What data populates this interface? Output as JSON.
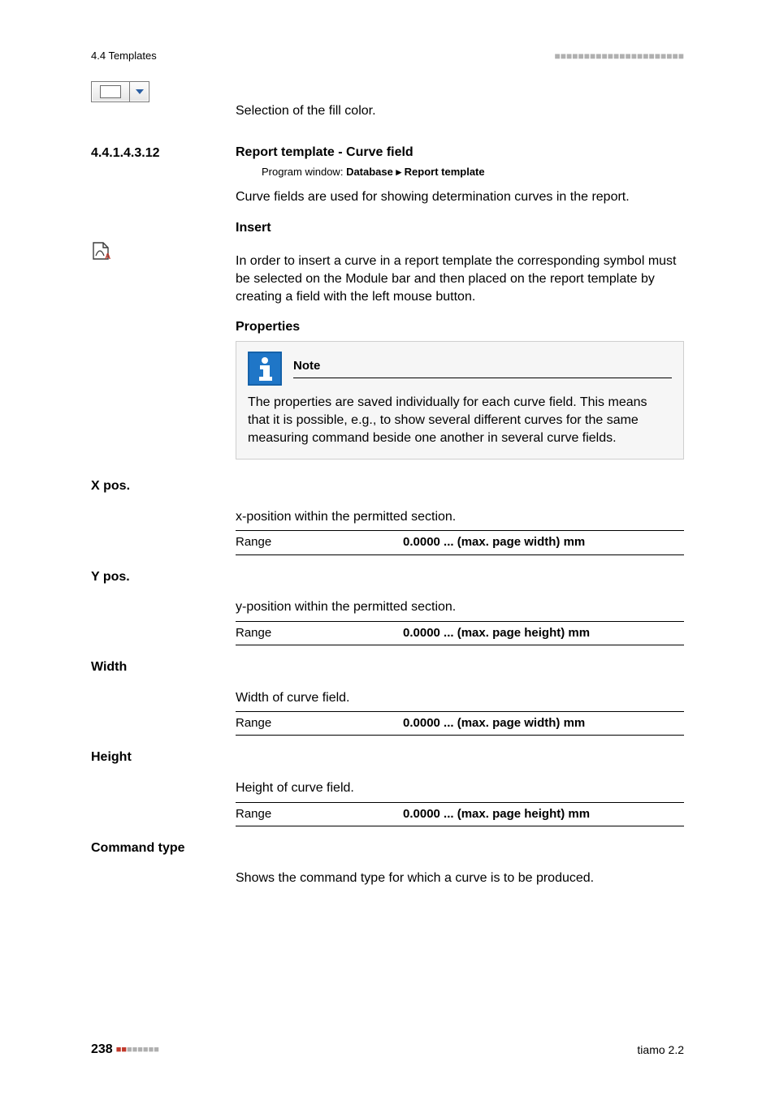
{
  "header": {
    "section": "4.4 Templates"
  },
  "fillcolor": {
    "caption": "Selection of the fill color."
  },
  "section": {
    "number": "4.4.1.4.3.12",
    "title": "Report template - Curve field",
    "program_window_label": "Program window:",
    "program_window_value_1": "Database",
    "program_window_sep": "▸",
    "program_window_value_2": "Report template",
    "intro": "Curve fields are used for showing determination curves in the report."
  },
  "insert": {
    "heading": "Insert",
    "text": "In order to insert a curve in a report template the corresponding symbol must be selected on the Module bar and then placed on the report template by creating a field with the left mouse button."
  },
  "properties": {
    "heading": "Properties",
    "note_title": "Note",
    "note_text": "The properties are saved individually for each curve field. This means that it is possible, e.g., to show several different curves for the same measuring command beside one another in several curve fields."
  },
  "props": {
    "xpos": {
      "label": "X pos.",
      "desc": "x-position within the permitted section.",
      "range_label": "Range",
      "range_value": "0.0000 ... (max. page width) mm"
    },
    "ypos": {
      "label": "Y pos.",
      "desc": "y-position within the permitted section.",
      "range_label": "Range",
      "range_value": "0.0000 ... (max. page height) mm"
    },
    "width": {
      "label": "Width",
      "desc": "Width of curve field.",
      "range_label": "Range",
      "range_value": "0.0000 ... (max. page width) mm"
    },
    "height": {
      "label": "Height",
      "desc": "Height of curve field.",
      "range_label": "Range",
      "range_value": "0.0000 ... (max. page height) mm"
    },
    "commandtype": {
      "label": "Command type",
      "desc": "Shows the command type for which a curve is to be produced."
    }
  },
  "footer": {
    "page": "238",
    "product": "tiamo 2.2"
  }
}
